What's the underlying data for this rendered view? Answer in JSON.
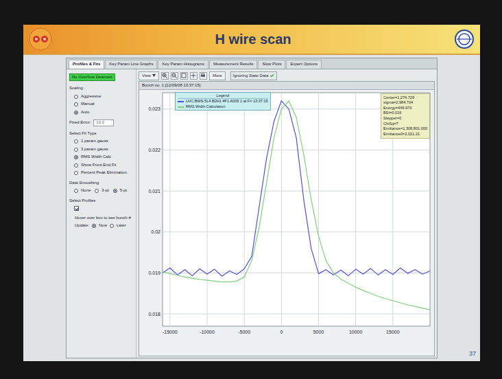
{
  "slide": {
    "title": "H wire scan",
    "page": "37"
  },
  "tabs": [
    {
      "label": "Profiles & Fits",
      "selected": true
    },
    {
      "label": "Key Param Line Graphs",
      "selected": false
    },
    {
      "label": "Key Param Histograms",
      "selected": false
    },
    {
      "label": "Measurement Results",
      "selected": false
    },
    {
      "label": "Slow Plots",
      "selected": false
    },
    {
      "label": "Expert Options",
      "selected": false
    }
  ],
  "sidebar": {
    "overflow": "No Overflow Detected",
    "scaling_label": "Scaling:",
    "scaling": [
      {
        "label": "Aggressive",
        "selected": false
      },
      {
        "label": "Manual",
        "selected": false
      },
      {
        "label": "Auto",
        "selected": true
      }
    ],
    "fixed_error_label": "Fixed Error:",
    "fixed_error": "10.0",
    "fit_label": "Select Fit Type",
    "fits": [
      {
        "label": "1 param gauss",
        "selected": false
      },
      {
        "label": "3 param gauss",
        "selected": false
      },
      {
        "label": "RMS Width Calc",
        "selected": true
      },
      {
        "label": "Show Front End Fit",
        "selected": false
      },
      {
        "label": "Percent Peak Elimination",
        "selected": false
      }
    ],
    "smoothing_label": "Data Smoothing",
    "smoothing": [
      {
        "label": "None",
        "selected": false
      },
      {
        "label": "3-pt",
        "selected": false
      },
      {
        "label": "5-pt",
        "selected": true
      }
    ],
    "profiles_label": "Select Profiles",
    "profiles_checked": true,
    "hover_text": "Hover over box to see bunch #",
    "update_label": "Update:",
    "update": [
      {
        "label": "Now",
        "selected": true
      },
      {
        "label": "Later",
        "selected": false
      }
    ]
  },
  "toolbar": {
    "view": "View",
    "more": "More",
    "status": "Ignoring State Data",
    "status_checked": true
  },
  "plot": {
    "title": "Bunch no. 1 [12/09/08 13:37:15]",
    "legend_title": "Legend",
    "legend": [
      "LHC.BWS.5L4.B2H1 #F1 A005 1 at Fri 13:37:15",
      "RMS Width Calculation"
    ],
    "stats": [
      "Center=1,274.729",
      "sigma=2,984.704",
      "Energy=449.970",
      "BSI=0.016",
      "Stepper=0",
      "ChiSq=?",
      "Emittance=1,308,801.000",
      "Emittance0=2,021.21"
    ],
    "y_ticks": [
      "0.023",
      "0.022",
      "0.021",
      "0.02",
      "0.019",
      "0.018"
    ],
    "x_ticks": [
      "-15000",
      "-10000",
      "-5000",
      "0",
      "5000",
      "10000",
      "15000"
    ],
    "x": [
      -16000,
      -15000,
      -14000,
      -13000,
      -12000,
      -11000,
      -10000,
      -9000,
      -8000,
      -7000,
      -6000,
      -5000,
      -4000,
      -3000,
      -2000,
      -1000,
      0,
      1000,
      2000,
      3000,
      4000,
      5000,
      6000,
      7000,
      8000,
      9000,
      10000,
      11000,
      12000,
      13000,
      14000,
      15000,
      16000,
      17000,
      18000,
      19000,
      20000
    ],
    "series": [
      {
        "color": "#5050e0",
        "values": [
          0.019,
          0.01912,
          0.01895,
          0.01908,
          0.01893,
          0.0191,
          0.01897,
          0.01909,
          0.01892,
          0.01905,
          0.01896,
          0.0191,
          0.0194,
          0.0206,
          0.0218,
          0.0227,
          0.0232,
          0.023,
          0.0223,
          0.0208,
          0.0196,
          0.01898,
          0.01908,
          0.01895,
          0.01907,
          0.01893,
          0.01909,
          0.01897,
          0.01911,
          0.01895,
          0.01908,
          0.01896,
          0.01912,
          0.01899,
          0.01908,
          0.01897,
          0.01905
        ]
      },
      {
        "color": "#7ed07e",
        "values": [
          0.01903,
          0.01898,
          0.01894,
          0.0189,
          0.01887,
          0.01884,
          0.01882,
          0.0188,
          0.01878,
          0.01878,
          0.0188,
          0.0189,
          0.0193,
          0.0201,
          0.0212,
          0.0223,
          0.023,
          0.0232,
          0.0228,
          0.0219,
          0.0208,
          0.0199,
          0.0193,
          0.019,
          0.01885,
          0.01875,
          0.01865,
          0.01857,
          0.0185,
          0.01843,
          0.01837,
          0.01832,
          0.01827,
          0.01822,
          0.01818,
          0.01814,
          0.0181
        ]
      }
    ]
  }
}
